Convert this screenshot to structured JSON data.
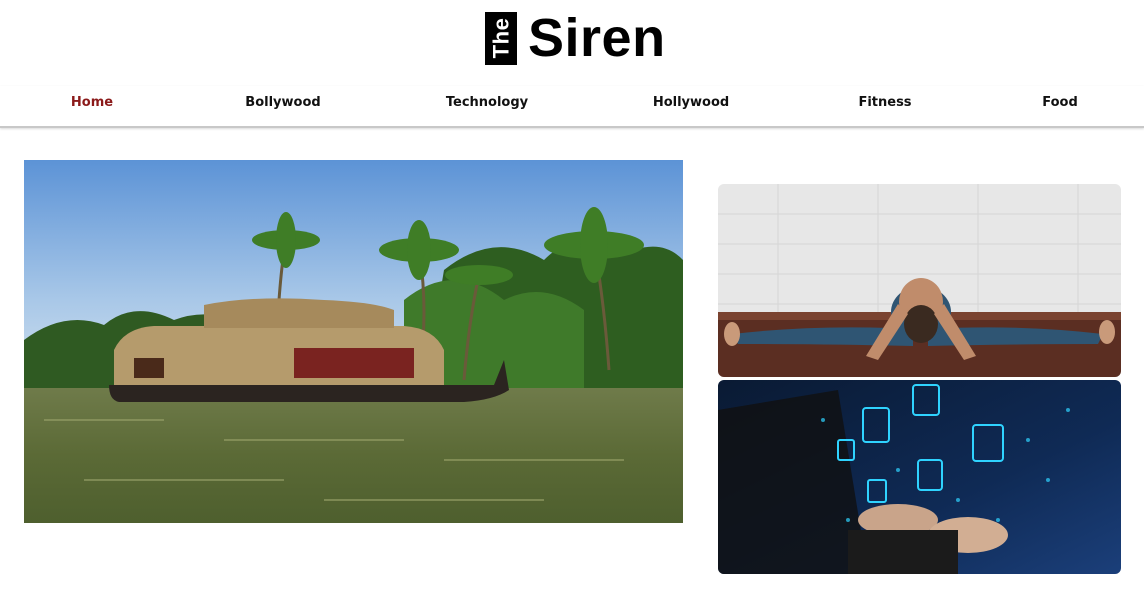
{
  "logo": {
    "badge": "The",
    "name": "Siren"
  },
  "nav": {
    "items": [
      {
        "label": "Home",
        "active": true
      },
      {
        "label": "Bollywood",
        "active": false
      },
      {
        "label": "Technology",
        "active": false
      },
      {
        "label": "Hollywood",
        "active": false
      },
      {
        "label": "Fitness",
        "active": false
      },
      {
        "label": "Food",
        "active": false
      }
    ]
  },
  "colors": {
    "active_nav": "#8b1a1a",
    "text": "#111111",
    "divider": "#c8c8c8"
  }
}
